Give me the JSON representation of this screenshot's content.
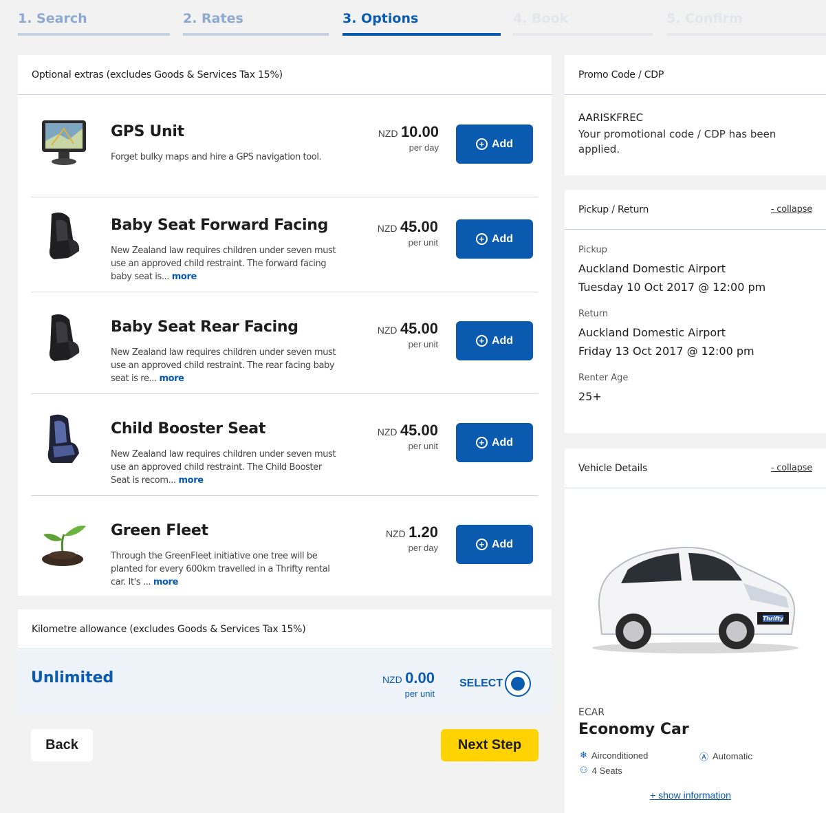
{
  "steps": [
    "1. Search",
    "2. Rates",
    "3. Options",
    "4. Book",
    "5. Confirm"
  ],
  "extras_header": "Optional extras (excludes Goods & Services Tax 15%)",
  "extras": [
    {
      "title": "GPS Unit",
      "desc": "Forget bulky maps and hire a GPS navigation tool.",
      "more": "",
      "currency": "NZD",
      "amount": "10.00",
      "unit": "per day",
      "add_label": "Add"
    },
    {
      "title": "Baby Seat Forward Facing",
      "desc": "New Zealand law requires children under seven must use an approved child restraint. The forward facing baby seat is...",
      "more": "more",
      "currency": "NZD",
      "amount": "45.00",
      "unit": "per unit",
      "add_label": "Add"
    },
    {
      "title": "Baby Seat Rear Facing",
      "desc": "New Zealand law requires children under seven must use an approved child restraint. The rear facing baby seat is re...",
      "more": "more",
      "currency": "NZD",
      "amount": "45.00",
      "unit": "per unit",
      "add_label": "Add"
    },
    {
      "title": "Child Booster Seat",
      "desc": "New Zealand law requires children under seven must use an approved child restraint. The Child Booster Seat is recom...",
      "more": "more",
      "currency": "NZD",
      "amount": "45.00",
      "unit": "per unit",
      "add_label": "Add"
    },
    {
      "title": "Green Fleet",
      "desc": "Through the GreenFleet initiative one tree will be planted for every 600km travelled in a Thrifty rental car. It's ...",
      "more": "more",
      "currency": "NZD",
      "amount": "1.20",
      "unit": "per day",
      "add_label": "Add"
    }
  ],
  "km": {
    "header": "Kilometre allowance (excludes Goods & Services Tax 15%)",
    "title": "Unlimited",
    "currency": "NZD",
    "amount": "0.00",
    "unit": "per unit",
    "select_label": "SELECT"
  },
  "buttons": {
    "back": "Back",
    "next": "Next Step"
  },
  "promo": {
    "header": "Promo Code / CDP",
    "code": "AARISKFREC",
    "message": "Your promotional code / CDP has been applied."
  },
  "pickup": {
    "header": "Pickup / Return",
    "collapse": "- collapse",
    "pickup_label": "Pickup",
    "pickup_location": "Auckland Domestic Airport",
    "pickup_time": "Tuesday 10 Oct 2017 @ 12:00 pm",
    "return_label": "Return",
    "return_location": "Auckland Domestic Airport",
    "return_time": "Friday 13 Oct 2017 @ 12:00 pm",
    "age_label": "Renter Age",
    "age_value": "25+"
  },
  "vehicle": {
    "header": "Vehicle Details",
    "collapse": "- collapse",
    "code": "ECAR",
    "name": "Economy Car",
    "features": [
      "Airconditioned",
      "Automatic",
      "4 Seats"
    ],
    "show_info": "+ show information",
    "badge": "Thrifty"
  },
  "colors": {
    "primary": "#0a5ab0",
    "next": "#ffd200"
  }
}
